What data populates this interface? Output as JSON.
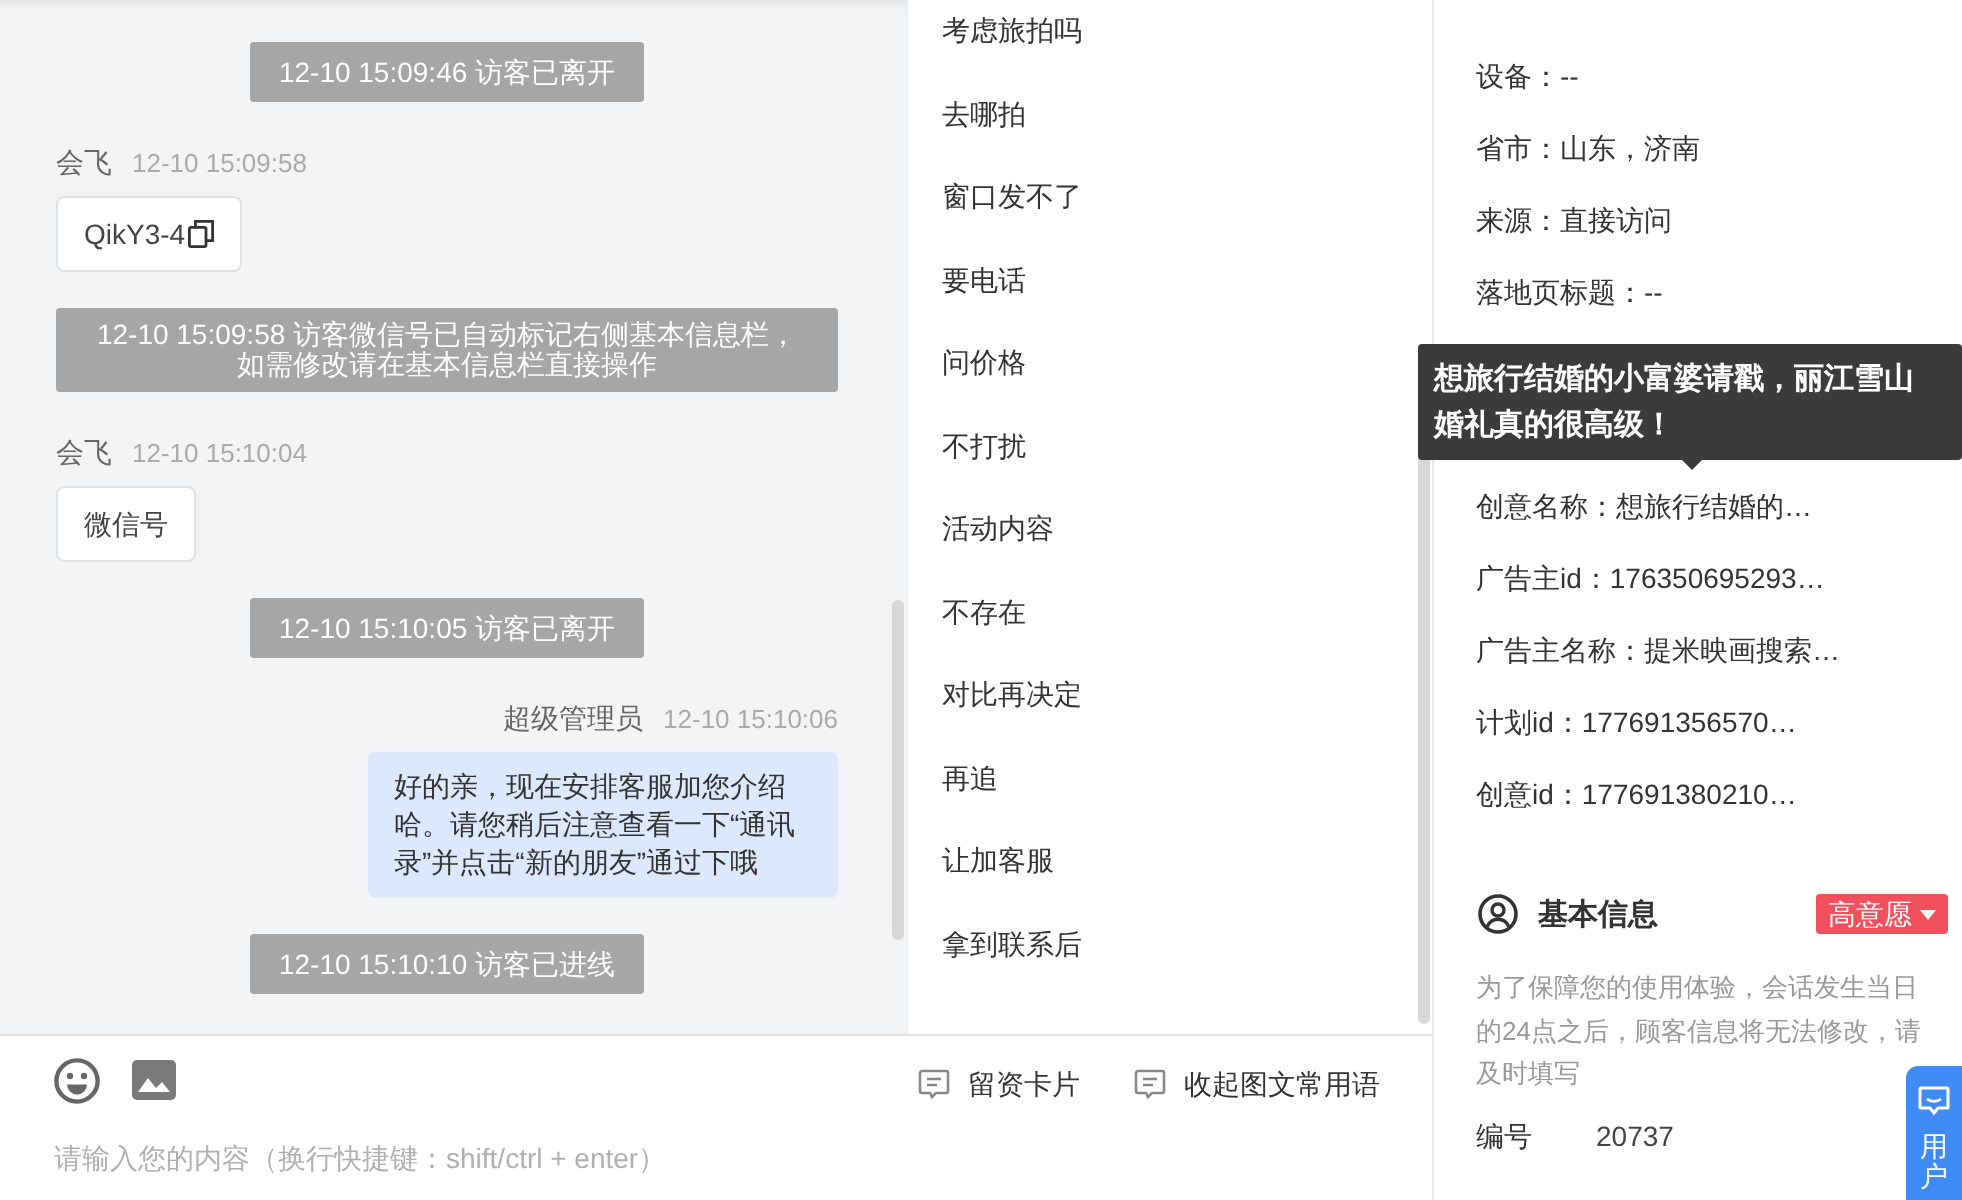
{
  "chat": {
    "messages": [
      {
        "kind": "notice",
        "lines": [
          "12-10 15:09:46 访客已离开"
        ]
      },
      {
        "kind": "message",
        "outgoing": false,
        "sender": "会飞",
        "time": "12-10 15:09:58",
        "text": "QikY3-4",
        "copyable": true
      },
      {
        "kind": "notice",
        "lines": [
          "12-10 15:09:58 访客微信号已自动标记右侧基本信息栏，",
          "如需修改请在基本信息栏直接操作"
        ]
      },
      {
        "kind": "message",
        "outgoing": false,
        "sender": "会飞",
        "time": "12-10 15:10:04",
        "text": "微信号",
        "copyable": false
      },
      {
        "kind": "notice",
        "lines": [
          "12-10 15:10:05 访客已离开"
        ]
      },
      {
        "kind": "message",
        "outgoing": true,
        "sender": "超级管理员",
        "time": "12-10 15:10:06",
        "text": "好的亲，现在安排客服加您介绍哈。请您稍后注意查看一下“通讯录”并点击“新的朋友”通过下哦",
        "copyable": false
      },
      {
        "kind": "notice",
        "lines": [
          "12-10 15:10:10 访客已进线"
        ]
      }
    ]
  },
  "quick_replies": {
    "items": [
      "考虑旅拍吗",
      "去哪拍",
      "窗口发不了",
      "要电话",
      "问价格",
      "不打扰",
      "活动内容",
      "不存在",
      "对比再决定",
      "再追",
      "让加客服",
      "拿到联系后"
    ]
  },
  "composer": {
    "actions": [
      "留资卡片",
      "收起图文常用语"
    ],
    "placeholder": "请输入您的内容（换行快捷键：shift/ctrl + enter）"
  },
  "source_info": {
    "fields": [
      {
        "text": "设备：--"
      },
      {
        "text": "省市：山东，济南"
      },
      {
        "text": "来源：直接访问"
      },
      {
        "text": "落地页标题：--"
      },
      {
        "text": "创意名称：想旅行结婚的…",
        "tooltip": "想旅行结婚的小富婆请戳，丽江雪山婚礼真的很高级！"
      },
      {
        "text": "广告主id：176350695293…"
      },
      {
        "text": "广告主名称：提米映画搜索…"
      },
      {
        "text": "计划id：177691356570…"
      },
      {
        "text": "创意id：177691380210…"
      }
    ]
  },
  "basic_info": {
    "title": "基本信息",
    "intent_tag": "高意愿",
    "notice": "为了保障您的使用体验，会话发生当日的24点之后，顾客信息将无法修改，请及时填写",
    "fields": [
      {
        "label": "编号",
        "value": "20737"
      }
    ]
  },
  "side_tab": {
    "label": "用户"
  }
}
